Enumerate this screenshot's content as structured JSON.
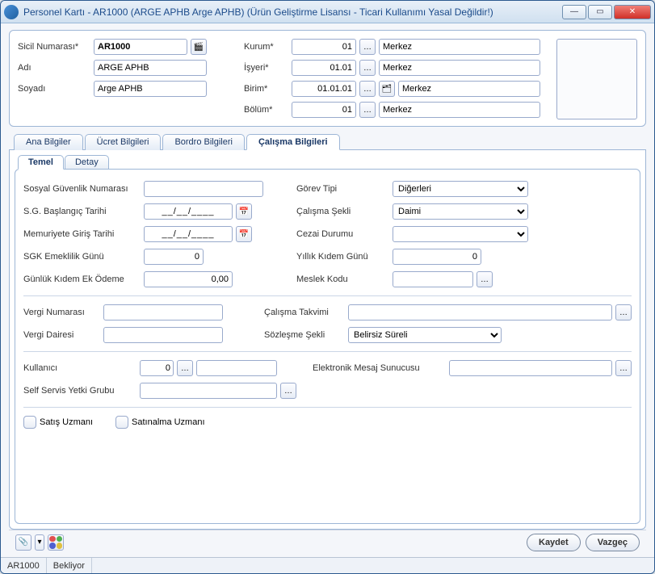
{
  "window": {
    "title": "Personel Kartı - AR1000 (ARGE APHB Arge APHB) (Ürün Geliştirme Lisansı - Ticari Kullanımı Yasal Değildir!)"
  },
  "header": {
    "labels": {
      "sicil": "Sicil Numarası*",
      "adi": "Adı",
      "soyadi": "Soyadı",
      "kurum": "Kurum*",
      "isyeri": "İşyeri*",
      "birim": "Birim*",
      "bolum": "Bölüm*"
    },
    "sicil": "AR1000",
    "adi": "ARGE APHB",
    "soyadi": "Arge APHB",
    "kurum": {
      "code": "01",
      "name": "Merkez"
    },
    "isyeri": {
      "code": "01.01",
      "name": "Merkez"
    },
    "birim": {
      "code": "01.01.01",
      "name": "Merkez"
    },
    "bolum": {
      "code": "01",
      "name": "Merkez"
    }
  },
  "tabs_outer": {
    "ana": "Ana Bilgiler",
    "ucret": "Ücret Bilgileri",
    "bordro": "Bordro Bilgileri",
    "calisma": "Çalışma Bilgileri"
  },
  "tabs_inner": {
    "temel": "Temel",
    "detay": "Detay"
  },
  "fields": {
    "sgn_label": "Sosyal Güvenlik Numarası",
    "sgn": "",
    "sg_bas_label": "S.G. Başlangıç Tarihi",
    "sg_bas": "__/__/____",
    "mem_label": "Memuriyete Giriş Tarihi",
    "mem": "__/__/____",
    "sgk_em_label": "SGK Emeklilik Günü",
    "sgk_em": "0",
    "gko_label": "Günlük Kıdem Ek Ödeme",
    "gko": "0,00",
    "gorev_label": "Görev Tipi",
    "gorev": "Diğerleri",
    "calis_label": "Çalışma Şekli",
    "calis": "Daimi",
    "cezai_label": "Cezai Durumu",
    "cezai": "",
    "yil_kidem_label": "Yıllık Kıdem Günü",
    "yil_kidem": "0",
    "meslek_label": "Meslek Kodu",
    "meslek": "",
    "vergi_no_label": "Vergi Numarası",
    "vergi_no": "",
    "vergi_daire_label": "Vergi Dairesi",
    "vergi_daire": "",
    "takvim_label": "Çalışma Takvimi",
    "takvim": "",
    "sozlesme_label": "Sözleşme Şekli",
    "sozlesme": "Belirsiz Süreli",
    "kullanici_label": "Kullanıcı",
    "kullanici": "0",
    "self_label": "Self Servis Yetki Grubu",
    "self": "",
    "eposta_label": "Elektronik Mesaj Sunucusu",
    "eposta": "",
    "satis": "Satış Uzmanı",
    "satin": "Satınalma Uzmanı"
  },
  "footer": {
    "kaydet": "Kaydet",
    "vazgec": "Vazgeç"
  },
  "status": {
    "left": "AR1000",
    "right": "Bekliyor"
  }
}
